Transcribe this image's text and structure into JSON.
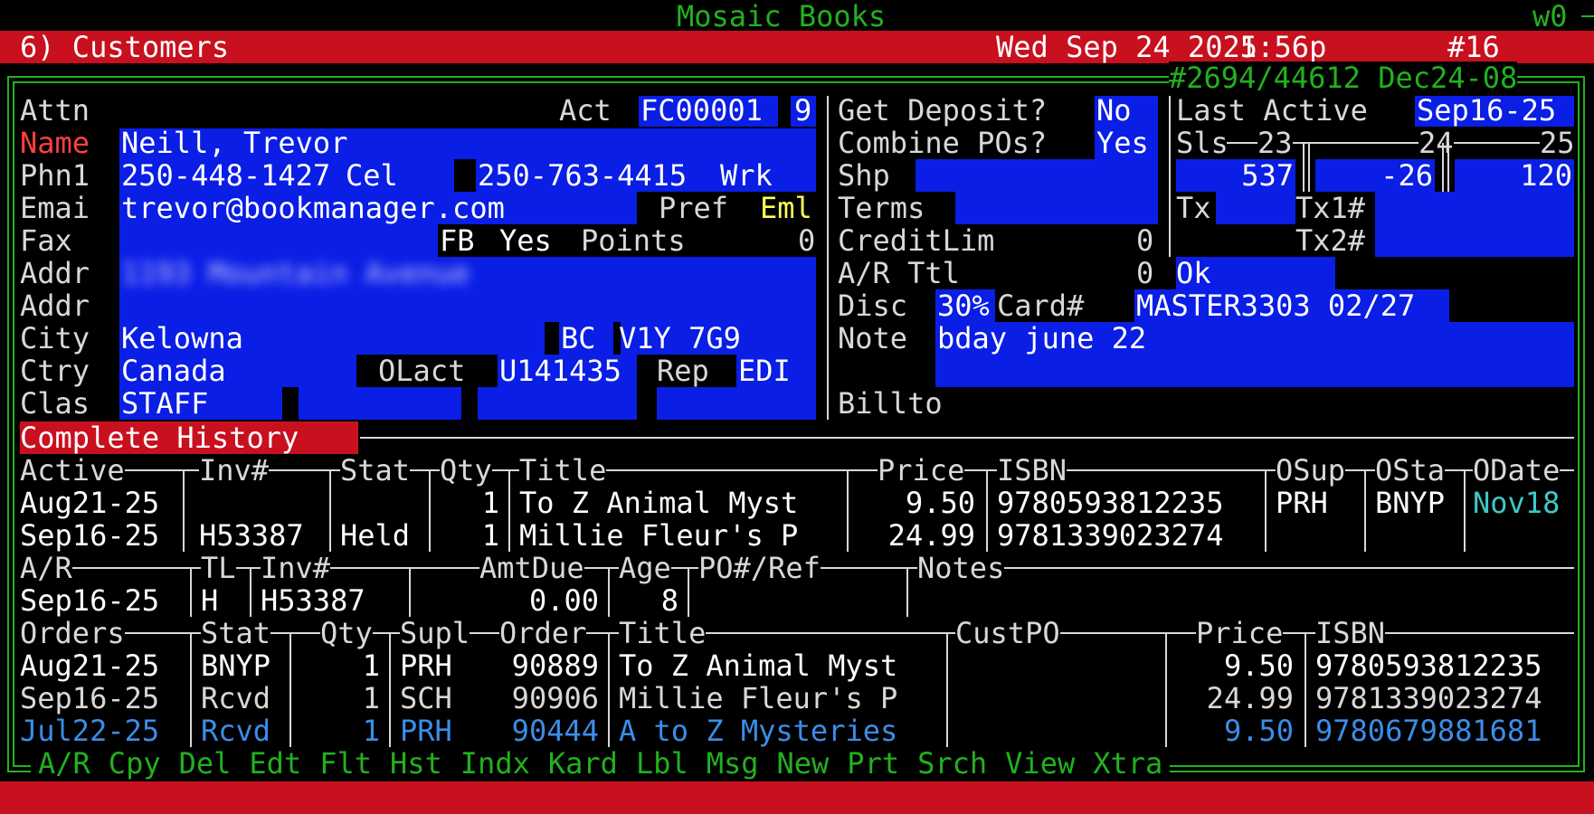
{
  "app": {
    "title": "Mosaic Books",
    "terminal_id": "w0"
  },
  "header": {
    "screen": "6) Customers",
    "date": "Wed Sep 24 2025",
    "time": "1:56p",
    "station": "#16"
  },
  "record": {
    "ref": "#2694/44612 Dec24-08"
  },
  "labels": {
    "attn": "Attn",
    "act": "Act",
    "name": "Name",
    "phn1": "Phn1",
    "cel": "Cel",
    "wrk": "Wrk",
    "emai": "Emai",
    "pref": "Pref",
    "fax": "Fax",
    "fb": "FB",
    "points": "Points",
    "addr1": "Addr",
    "addr2": "Addr",
    "city": "City",
    "ctry": "Ctry",
    "olact": "OLact",
    "rep": "Rep",
    "clas": "Clas",
    "get_deposit": "Get Deposit?",
    "combine_pos": "Combine POs?",
    "shp": "Shp",
    "terms": "Terms",
    "creditlim": "CreditLim",
    "ar_ttl": "A/R Ttl",
    "disc": "Disc",
    "card": "Card#",
    "note": "Note",
    "billto": "Billto",
    "last_active": "Last Active",
    "tx": "Tx",
    "tx1": "Tx1#",
    "tx2": "Tx2#"
  },
  "customer": {
    "act": "FC00001",
    "act_check": "9",
    "name": "Neill, Trevor",
    "phone1": "250-448-1427",
    "phone2": "250-763-4415",
    "email": "trevor@bookmanager.com",
    "pref": "Eml",
    "fb": "Yes",
    "points": "0",
    "addr1": "1193 Mountain Avenue",
    "city": "Kelowna",
    "prov": "BC",
    "postal": "V1Y 7G9",
    "country": "Canada",
    "olact": "U141435",
    "rep": "EDI",
    "clas": "STAFF",
    "get_deposit": "No",
    "combine_pos": "Yes",
    "creditlim": "0",
    "ar_ttl": "0",
    "ar_status": "Ok",
    "disc": "30%",
    "card": "MASTER3303 02/27",
    "note": "bday june 22",
    "last_active": "Sep16-25"
  },
  "sales": {
    "header": "Sls",
    "y23": "23",
    "y24": "24",
    "y25": "25",
    "v23": "537",
    "v24": "-26",
    "v25": "120"
  },
  "history": {
    "title": "Complete History",
    "columns": [
      "Active",
      "Inv#",
      "Stat",
      "Qty",
      "Title",
      "Price",
      "ISBN",
      "OSup",
      "OSta",
      "ODate"
    ],
    "rows": [
      {
        "active": "Aug21-25",
        "inv": "",
        "stat": "",
        "qty": "1",
        "title": "To Z Animal Myst",
        "price": "9.50",
        "isbn": "9780593812235",
        "osup": "PRH",
        "osta": "BNYP",
        "odate": "Nov18"
      },
      {
        "active": "Sep16-25",
        "inv": "H53387",
        "stat": "Held",
        "qty": "1",
        "title": "Millie Fleur's P",
        "price": "24.99",
        "isbn": "9781339023274",
        "osup": "",
        "osta": "",
        "odate": ""
      }
    ]
  },
  "ar": {
    "columns": [
      "A/R",
      "TL",
      "Inv#",
      "AmtDue",
      "Age",
      "PO#/Ref",
      "Notes"
    ],
    "rows": [
      {
        "date": "Sep16-25",
        "tl": "H",
        "inv": "H53387",
        "amt": "0.00",
        "age": "8",
        "po": "",
        "notes": ""
      }
    ]
  },
  "orders": {
    "columns": [
      "Orders",
      "Stat",
      "Qty",
      "Supl",
      "Order",
      "Title",
      "CustPO",
      "Price",
      "ISBN"
    ],
    "rows": [
      {
        "date": "Aug21-25",
        "stat": "BNYP",
        "qty": "1",
        "supl": "PRH",
        "order": "90889",
        "title": "To Z Animal Myst",
        "custpo": "",
        "price": "9.50",
        "isbn": "9780593812235"
      },
      {
        "date": "Sep16-25",
        "stat": "Rcvd",
        "qty": "1",
        "supl": "SCH",
        "order": "90906",
        "title": "Millie Fleur's P",
        "custpo": "",
        "price": "24.99",
        "isbn": "9781339023274"
      },
      {
        "date": "Jul22-25",
        "stat": "Rcvd",
        "qty": "1",
        "supl": "PRH",
        "order": "90444",
        "title": "A to Z Mysteries",
        "custpo": "",
        "price": "9.50",
        "isbn": "9780679881681"
      }
    ]
  },
  "menu": [
    "A/R",
    "Cpy",
    "Del",
    "Edt",
    "Flt",
    "Hst",
    "Indx",
    "Kard",
    "Lbl",
    "Msg",
    "New",
    "Prt",
    "Srch",
    "View",
    "Xtra"
  ],
  "colors": {
    "header_bar": "#c8101e",
    "field_bg": "#0a1ee6",
    "frame": "#22b11e",
    "accent_yellow": "#ffff55",
    "label_red": "#ff4040",
    "date_cyan": "#3fc8c8",
    "row_blue": "#3a8ee8"
  }
}
